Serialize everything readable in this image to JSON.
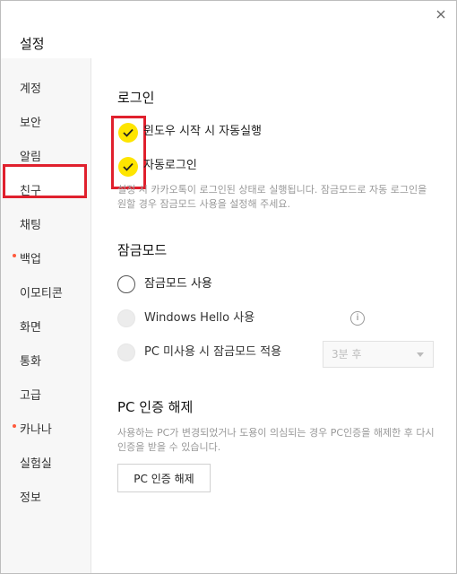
{
  "window": {
    "title": "설정"
  },
  "sidebar": {
    "items": [
      {
        "label": "계정"
      },
      {
        "label": "보안"
      },
      {
        "label": "알림"
      },
      {
        "label": "친구"
      },
      {
        "label": "채팅"
      },
      {
        "label": "백업"
      },
      {
        "label": "이모티콘"
      },
      {
        "label": "화면"
      },
      {
        "label": "통화"
      },
      {
        "label": "고급"
      },
      {
        "label": "카나나"
      },
      {
        "label": "실험실"
      },
      {
        "label": "정보"
      }
    ],
    "selected": "보안"
  },
  "login": {
    "title": "로그인",
    "auto_start": {
      "label": "윈도우 시작 시 자동실행",
      "checked": true
    },
    "auto_login": {
      "label": "자동로그인",
      "checked": true
    },
    "description": "설정 시 카카오톡이 로그인된 상태로 실행됩니다. 잠금모드로 자동 로그인을 원할 경우 잠금모드 사용을 설정해 주세요."
  },
  "lock_mode": {
    "title": "잠금모드",
    "use_lock": {
      "label": "잠금모드 사용"
    },
    "windows_hello": {
      "label": "Windows Hello 사용",
      "info": "i"
    },
    "idle_lock": {
      "label": "PC 미사용 시 잠금모드 적용",
      "select_value": "3분 후"
    }
  },
  "pc_auth": {
    "title": "PC 인증 해제",
    "description": "사용하는 PC가 변경되었거나 도용이 의심되는 경우 PC인증을 해제한 후 다시 인증을 받을 수 있습니다.",
    "button_label": "PC 인증 해제"
  },
  "colors": {
    "accent": "#fee500",
    "highlight": "#e0202d",
    "badge_dot": "#ff5a3d"
  }
}
